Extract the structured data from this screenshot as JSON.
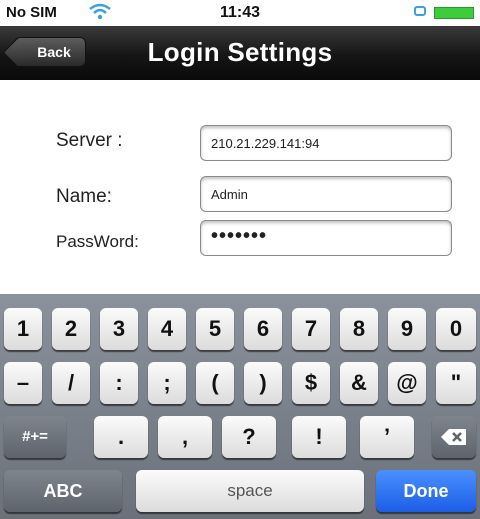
{
  "status_bar": {
    "carrier": "No SIM",
    "time": "11:43"
  },
  "nav_bar": {
    "back_label": "Back",
    "title": "Login Settings"
  },
  "form": {
    "server_label": "Server :",
    "server_value": "210.21.229.141:94",
    "name_label": "Name:",
    "name_value": "Admin",
    "password_label": "PassWord:",
    "password_value": "•••••••"
  },
  "keyboard": {
    "row1": [
      "1",
      "2",
      "3",
      "4",
      "5",
      "6",
      "7",
      "8",
      "9",
      "0"
    ],
    "row2": [
      "–",
      "/",
      ":",
      ";",
      "(",
      ")",
      "$",
      "&",
      "@",
      "\""
    ],
    "row3": [
      ".",
      ",",
      "?",
      "!",
      "’"
    ],
    "mode_key": "#+=",
    "abc_key": "ABC",
    "space_key": "space",
    "done_key": "Done",
    "delete_icon": "backspace-icon"
  },
  "colors": {
    "done_blue": "#1c5ee6",
    "battery_green": "#3ccc3c",
    "wifi_blue": "#3aa0e0"
  }
}
